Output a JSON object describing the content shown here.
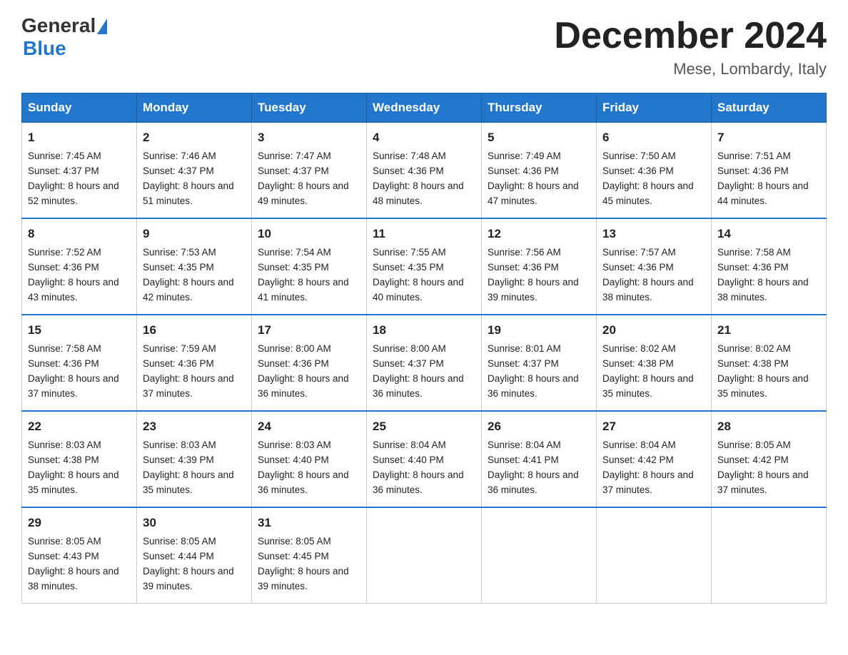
{
  "header": {
    "logo_general": "General",
    "logo_blue": "Blue",
    "title": "December 2024",
    "subtitle": "Mese, Lombardy, Italy"
  },
  "days_of_week": [
    "Sunday",
    "Monday",
    "Tuesday",
    "Wednesday",
    "Thursday",
    "Friday",
    "Saturday"
  ],
  "weeks": [
    [
      {
        "day": "1",
        "sunrise": "7:45 AM",
        "sunset": "4:37 PM",
        "daylight": "8 hours and 52 minutes."
      },
      {
        "day": "2",
        "sunrise": "7:46 AM",
        "sunset": "4:37 PM",
        "daylight": "8 hours and 51 minutes."
      },
      {
        "day": "3",
        "sunrise": "7:47 AM",
        "sunset": "4:37 PM",
        "daylight": "8 hours and 49 minutes."
      },
      {
        "day": "4",
        "sunrise": "7:48 AM",
        "sunset": "4:36 PM",
        "daylight": "8 hours and 48 minutes."
      },
      {
        "day": "5",
        "sunrise": "7:49 AM",
        "sunset": "4:36 PM",
        "daylight": "8 hours and 47 minutes."
      },
      {
        "day": "6",
        "sunrise": "7:50 AM",
        "sunset": "4:36 PM",
        "daylight": "8 hours and 45 minutes."
      },
      {
        "day": "7",
        "sunrise": "7:51 AM",
        "sunset": "4:36 PM",
        "daylight": "8 hours and 44 minutes."
      }
    ],
    [
      {
        "day": "8",
        "sunrise": "7:52 AM",
        "sunset": "4:36 PM",
        "daylight": "8 hours and 43 minutes."
      },
      {
        "day": "9",
        "sunrise": "7:53 AM",
        "sunset": "4:35 PM",
        "daylight": "8 hours and 42 minutes."
      },
      {
        "day": "10",
        "sunrise": "7:54 AM",
        "sunset": "4:35 PM",
        "daylight": "8 hours and 41 minutes."
      },
      {
        "day": "11",
        "sunrise": "7:55 AM",
        "sunset": "4:35 PM",
        "daylight": "8 hours and 40 minutes."
      },
      {
        "day": "12",
        "sunrise": "7:56 AM",
        "sunset": "4:36 PM",
        "daylight": "8 hours and 39 minutes."
      },
      {
        "day": "13",
        "sunrise": "7:57 AM",
        "sunset": "4:36 PM",
        "daylight": "8 hours and 38 minutes."
      },
      {
        "day": "14",
        "sunrise": "7:58 AM",
        "sunset": "4:36 PM",
        "daylight": "8 hours and 38 minutes."
      }
    ],
    [
      {
        "day": "15",
        "sunrise": "7:58 AM",
        "sunset": "4:36 PM",
        "daylight": "8 hours and 37 minutes."
      },
      {
        "day": "16",
        "sunrise": "7:59 AM",
        "sunset": "4:36 PM",
        "daylight": "8 hours and 37 minutes."
      },
      {
        "day": "17",
        "sunrise": "8:00 AM",
        "sunset": "4:36 PM",
        "daylight": "8 hours and 36 minutes."
      },
      {
        "day": "18",
        "sunrise": "8:00 AM",
        "sunset": "4:37 PM",
        "daylight": "8 hours and 36 minutes."
      },
      {
        "day": "19",
        "sunrise": "8:01 AM",
        "sunset": "4:37 PM",
        "daylight": "8 hours and 36 minutes."
      },
      {
        "day": "20",
        "sunrise": "8:02 AM",
        "sunset": "4:38 PM",
        "daylight": "8 hours and 35 minutes."
      },
      {
        "day": "21",
        "sunrise": "8:02 AM",
        "sunset": "4:38 PM",
        "daylight": "8 hours and 35 minutes."
      }
    ],
    [
      {
        "day": "22",
        "sunrise": "8:03 AM",
        "sunset": "4:38 PM",
        "daylight": "8 hours and 35 minutes."
      },
      {
        "day": "23",
        "sunrise": "8:03 AM",
        "sunset": "4:39 PM",
        "daylight": "8 hours and 35 minutes."
      },
      {
        "day": "24",
        "sunrise": "8:03 AM",
        "sunset": "4:40 PM",
        "daylight": "8 hours and 36 minutes."
      },
      {
        "day": "25",
        "sunrise": "8:04 AM",
        "sunset": "4:40 PM",
        "daylight": "8 hours and 36 minutes."
      },
      {
        "day": "26",
        "sunrise": "8:04 AM",
        "sunset": "4:41 PM",
        "daylight": "8 hours and 36 minutes."
      },
      {
        "day": "27",
        "sunrise": "8:04 AM",
        "sunset": "4:42 PM",
        "daylight": "8 hours and 37 minutes."
      },
      {
        "day": "28",
        "sunrise": "8:05 AM",
        "sunset": "4:42 PM",
        "daylight": "8 hours and 37 minutes."
      }
    ],
    [
      {
        "day": "29",
        "sunrise": "8:05 AM",
        "sunset": "4:43 PM",
        "daylight": "8 hours and 38 minutes."
      },
      {
        "day": "30",
        "sunrise": "8:05 AM",
        "sunset": "4:44 PM",
        "daylight": "8 hours and 39 minutes."
      },
      {
        "day": "31",
        "sunrise": "8:05 AM",
        "sunset": "4:45 PM",
        "daylight": "8 hours and 39 minutes."
      },
      null,
      null,
      null,
      null
    ]
  ],
  "labels": {
    "sunrise": "Sunrise:",
    "sunset": "Sunset:",
    "daylight": "Daylight:"
  }
}
